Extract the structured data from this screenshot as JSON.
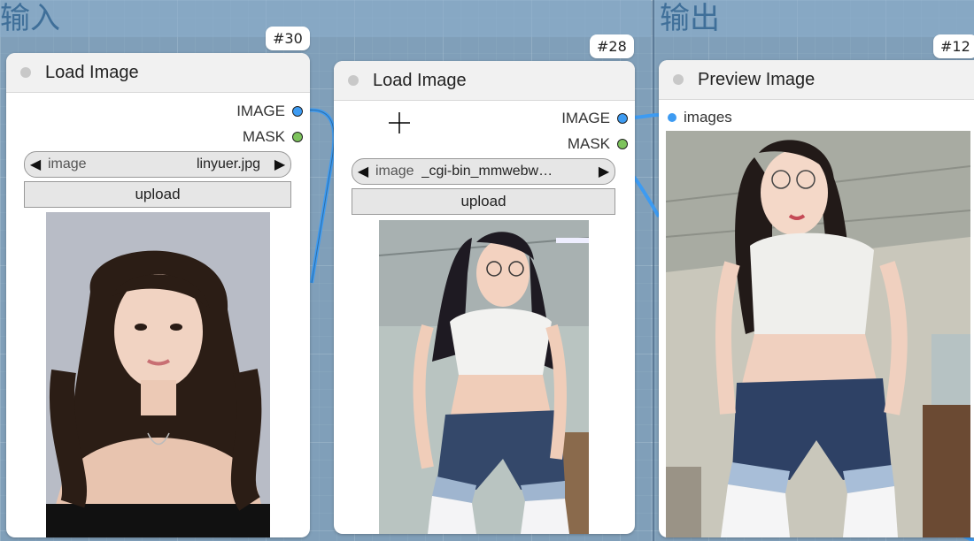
{
  "groups": [
    {
      "title": "输入"
    },
    {
      "title": "输出"
    }
  ],
  "nodes": [
    {
      "id": "#30",
      "title": "Load Image",
      "outputs": [
        "IMAGE",
        "MASK"
      ],
      "widget": {
        "name": "image",
        "value": "linyuer.jpg"
      },
      "button": "upload"
    },
    {
      "id": "#28",
      "title": "Load Image",
      "outputs": [
        "IMAGE",
        "MASK"
      ],
      "widget": {
        "name": "image",
        "value": "_cgi-bin_mmwebw…"
      },
      "button": "upload"
    },
    {
      "id": "#12",
      "title": "Preview Image",
      "inputs": [
        "images"
      ]
    }
  ],
  "colors": {
    "image_port": "#3d9bf2",
    "mask_port": "#7dc35c",
    "link": "#3d9bf2",
    "canvas": "#8aa7bf"
  }
}
